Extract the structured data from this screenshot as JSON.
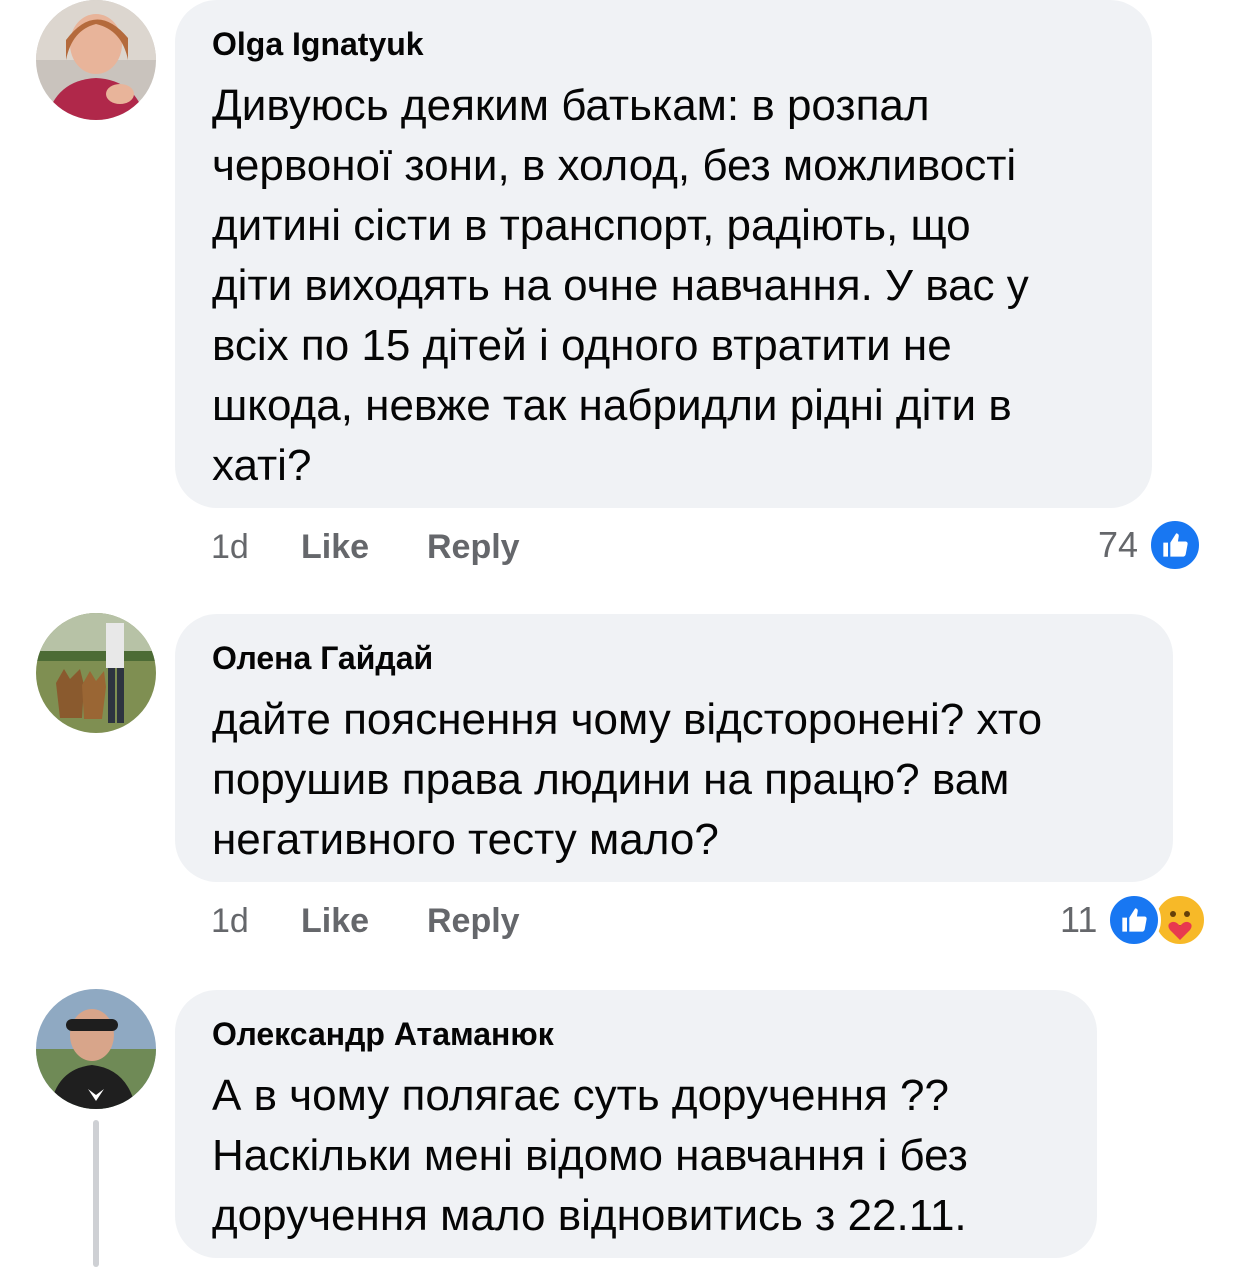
{
  "comments": [
    {
      "author": "Olga Ignatyuk",
      "text": "Дивуюсь деяким батькам: в розпал\nчервоної зони, в холод, без можливості\nдитині сісти в транспорт, радіють, що\nдіти виходять на очне навчання. У вас у\nвсіх по 15 дітей і одного втратити не\nшкода, невже так набридли рідні діти в\nхаті?",
      "time": "1d",
      "like_label": "Like",
      "reply_label": "Reply",
      "reaction_count": "74",
      "reactions": [
        "like-icon"
      ]
    },
    {
      "author": "Олена Гайдай",
      "text": "дайте пояснення чому відсторонені? хто\nпорушив права людини на працю? вам\nнегативного тесту мало?",
      "time": "1d",
      "like_label": "Like",
      "reply_label": "Reply",
      "reaction_count": "11",
      "reactions": [
        "like-icon",
        "care-icon"
      ]
    },
    {
      "author": "Олександр Атаманюк",
      "text": "А в чому полягає суть доручення ??\nНаскільки мені відомо навчання і без\nдоручення мало відновитись з 22.11."
    }
  ],
  "colors": {
    "bubble": "#f0f2f5",
    "meta_text": "#65676b",
    "like_blue": "#1877f2",
    "care_yellow": "#f7b928"
  }
}
